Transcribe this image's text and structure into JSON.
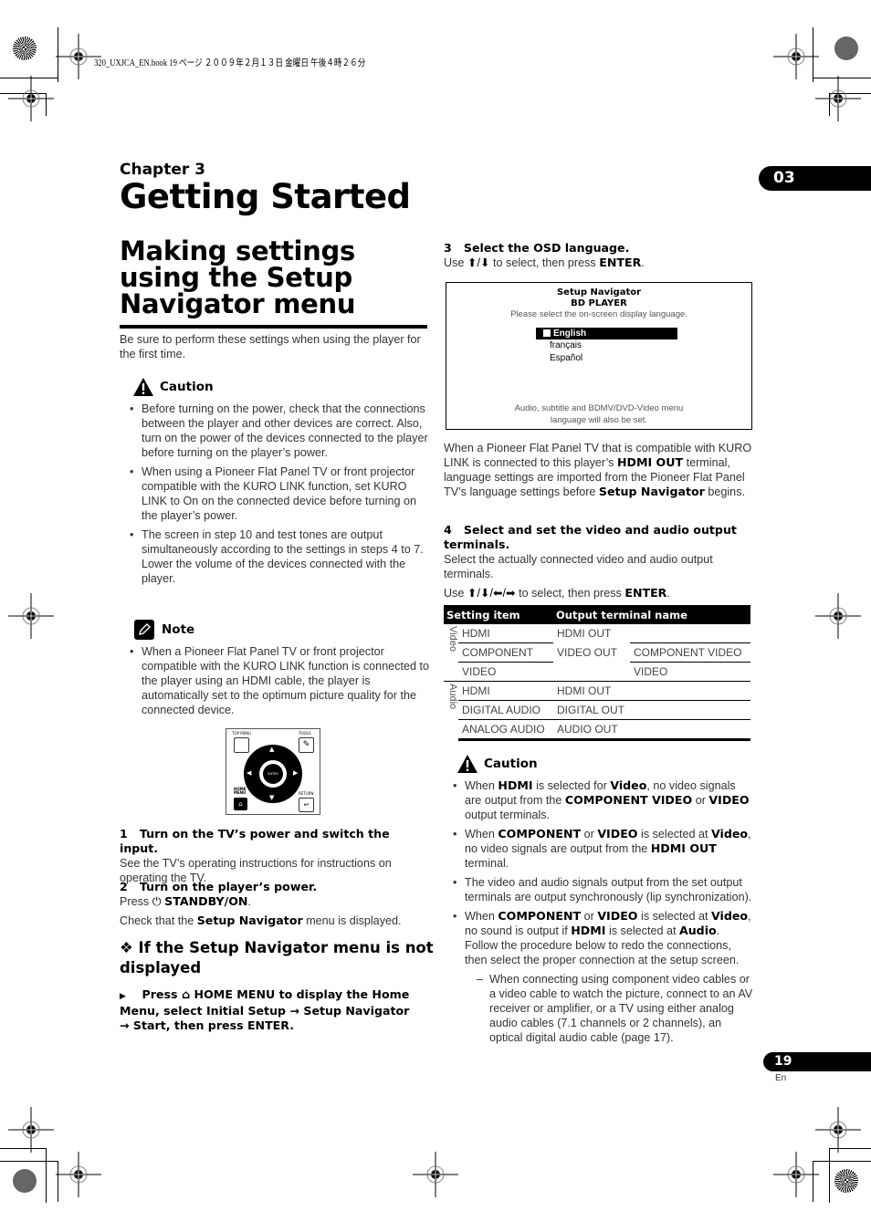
{
  "print_header": "320_UXJCA_EN.book  19 ページ  ２００９年２月１３日  金曜日  午後４時２６分",
  "chapter": {
    "label": "Chapter 3",
    "title": "Getting Started",
    "tab_number": "03"
  },
  "section": {
    "title": "Making settings using the Setup Navigator menu",
    "intro": "Be sure to perform these settings when using the player for the first time."
  },
  "caution_left": {
    "heading": "Caution",
    "icon": "warning-icon",
    "items": [
      "Before turning on the power, check that the connections between the player and other devices are correct. Also, turn on the power of the devices connected to the player before turning on the player’s power.",
      "When using a Pioneer Flat Panel TV or front projector compatible with the KURO LINK function, set KURO LINK to On on the connected device before turning on the player’s power.",
      "The screen in step 10 and test tones are output simultaneously according to the settings in steps 4 to 7. Lower the volume of the devices connected with the player."
    ]
  },
  "note": {
    "heading": "Note",
    "icon": "pencil-icon",
    "items": [
      "When a Pioneer Flat Panel TV or front projector compatible with the KURO LINK function is connected to the player using an HDMI cable, the player is automatically set to the optimum picture quality for the connected device."
    ]
  },
  "remote_illustration": {
    "top_menu": "TOP MENU",
    "tools": "TOOLS",
    "enter": "ENTER",
    "home_menu": "HOME MENU",
    "return": "RETURN"
  },
  "steps": {
    "s1": {
      "number": "1",
      "title": "Turn on the TV’s power and switch the input.",
      "body": "See the TV’s operating instructions for instructions on operating the TV."
    },
    "s2": {
      "number": "2",
      "title": "Turn on the player’s power.",
      "press": "Press",
      "button": "STANDBY/ON",
      "check_pre": "Check that the",
      "check_bold": "Setup Navigator",
      "check_post": "menu is displayed."
    },
    "s3": {
      "number": "3",
      "title": "Select the OSD language.",
      "use_pre": "Use",
      "arrows": "⬆/⬇",
      "use_post": "to select, then press",
      "enter": "ENTER"
    },
    "s4": {
      "number": "4",
      "title": "Select and set the video and audio output terminals.",
      "body": "Select the actually connected video and audio output terminals.",
      "use_pre": "Use",
      "arrows": "⬆/⬇/⬅/➡",
      "use_post": "to select, then press",
      "enter": "ENTER"
    }
  },
  "subsection": {
    "marker": "❖",
    "title": "If the Setup Navigator menu is not displayed",
    "instruction_marker": "▶",
    "instruction_press": "Press",
    "instruction_rest": "HOME MENU to display the Home Menu, select Initial Setup → Setup Navigator → Start, then press ENTER."
  },
  "osd_screen": {
    "title": "Setup Navigator",
    "subtitle": "BD PLAYER",
    "prompt": "Please select the on-screen display language.",
    "options": [
      "English",
      "français",
      "Español"
    ],
    "selected": "English",
    "footer_line1": "Audio, subtitle and BDMV/DVD-Video menu",
    "footer_line2": "language will also be set."
  },
  "kuro_link_para": {
    "t1": "When a Pioneer Flat Panel TV that is compatible with KURO LINK is connected to this player’s",
    "b1": "HDMI OUT",
    "t2": "terminal, language settings are imported from the Pioneer Flat Panel TV’s language settings before",
    "b2": "Setup Navigator",
    "t3": "begins."
  },
  "output_table": {
    "headers": [
      "Setting item",
      "Output terminal name"
    ],
    "groups": [
      {
        "name": "Video",
        "rows": [
          [
            "HDMI",
            "HDMI OUT",
            ""
          ],
          [
            "COMPONENT",
            "VIDEO OUT",
            "COMPONENT VIDEO"
          ],
          [
            "VIDEO",
            "",
            "VIDEO"
          ]
        ]
      },
      {
        "name": "Audio",
        "rows": [
          [
            "HDMI",
            "HDMI OUT",
            ""
          ],
          [
            "DIGITAL AUDIO",
            "DIGITAL OUT",
            ""
          ],
          [
            "ANALOG AUDIO",
            "AUDIO OUT",
            ""
          ]
        ]
      }
    ]
  },
  "caution_right": {
    "heading": "Caution",
    "items": [
      {
        "parts": [
          [
            "When ",
            false
          ],
          [
            "HDMI",
            true
          ],
          [
            " is selected for ",
            false
          ],
          [
            "Video",
            true
          ],
          [
            ", no video signals are output from the ",
            false
          ],
          [
            "COMPONENT VIDEO",
            true
          ],
          [
            " or ",
            false
          ],
          [
            "VIDEO",
            true
          ],
          [
            " output terminals.",
            false
          ]
        ]
      },
      {
        "parts": [
          [
            "When ",
            false
          ],
          [
            "COMPONENT",
            true
          ],
          [
            " or ",
            false
          ],
          [
            "VIDEO",
            true
          ],
          [
            " is selected at ",
            false
          ],
          [
            "Video",
            true
          ],
          [
            ", no video signals are output from the ",
            false
          ],
          [
            "HDMI OUT",
            true
          ],
          [
            " terminal.",
            false
          ]
        ]
      },
      {
        "parts": [
          [
            "The video and audio signals output from the set output terminals are output synchronously (lip synchronization).",
            false
          ]
        ]
      },
      {
        "parts": [
          [
            "When ",
            false
          ],
          [
            "COMPONENT",
            true
          ],
          [
            " or ",
            false
          ],
          [
            "VIDEO",
            true
          ],
          [
            " is selected at ",
            false
          ],
          [
            "Video",
            true
          ],
          [
            ", no sound is output if ",
            false
          ],
          [
            "HDMI",
            true
          ],
          [
            " is selected at ",
            false
          ],
          [
            "Audio",
            true
          ],
          [
            ". Follow the procedure below to redo the connections, then select the proper connection at the setup screen.",
            false
          ]
        ]
      }
    ],
    "subitem": "When connecting using component video cables or a video cable to watch the picture, connect to an AV receiver or amplifier, or a TV using either analog audio cables (7.1 channels or 2 channels), an optical digital audio cable (page 17)."
  },
  "footer": {
    "page_number": "19",
    "language": "En"
  }
}
